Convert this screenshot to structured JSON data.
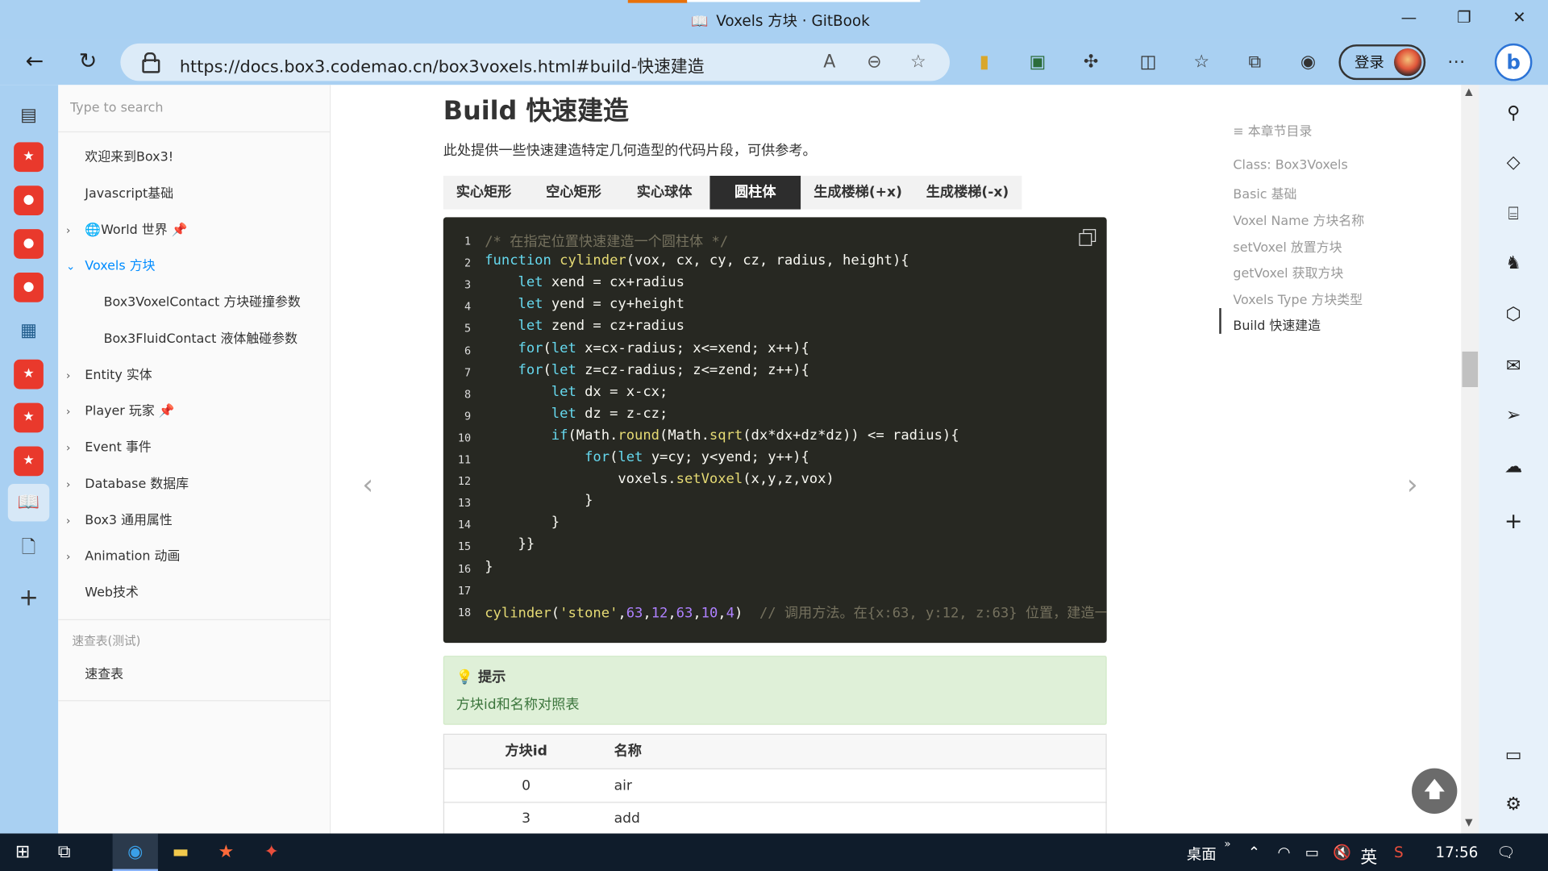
{
  "window": {
    "title": "Voxels 方块 · GitBook",
    "minimize": "—",
    "restore": "❐",
    "close": "✕"
  },
  "browser": {
    "url": "https://docs.box3.codemao.cn/box3voxels.html#build-快速建造",
    "login_label": "登录",
    "bing": "b"
  },
  "sidebar": {
    "search_placeholder": "Type to search",
    "items": [
      {
        "label": "欢迎来到Box3!"
      },
      {
        "label": "Javascript基础"
      },
      {
        "label": "🌐World 世界 📌"
      },
      {
        "label": "Voxels 方块"
      },
      {
        "label": "Box3VoxelContact 方块碰撞参数"
      },
      {
        "label": "Box3FluidContact 液体触碰参数"
      },
      {
        "label": "Entity 实体"
      },
      {
        "label": "Player 玩家 📌"
      },
      {
        "label": "Event 事件"
      },
      {
        "label": "Database 数据库"
      },
      {
        "label": "Box3 通用属性"
      },
      {
        "label": "Animation 动画"
      },
      {
        "label": "Web技术"
      }
    ],
    "section_header": "速查表(测试)",
    "section_item": "速查表"
  },
  "main": {
    "heading": "Build 快速建造",
    "intro": "此处提供一些快速建造特定几何造型的代码片段，可供参考。",
    "tabs": [
      "实心矩形",
      "空心矩形",
      "实心球体",
      "圆柱体",
      "生成楼梯(+x)",
      "生成楼梯(-x)"
    ],
    "selected_tab": "圆柱体",
    "hint_title": "提示",
    "hint_body": "方块id和名称对照表",
    "table": {
      "headers": [
        "方块id",
        "名称"
      ],
      "rows": [
        [
          "0",
          "air"
        ],
        [
          "3",
          "add"
        ]
      ]
    }
  },
  "code": {
    "lines": [
      "/* 在指定位置快速建造一个圆柱体 */",
      "function cylinder(vox, cx, cy, cz, radius, height){",
      "    let xend = cx+radius",
      "    let yend = cy+height",
      "    let zend = cz+radius",
      "    for(let x=cx-radius; x<=xend; x++){",
      "    for(let z=cz-radius; z<=zend; z++){",
      "        let dx = x-cx;",
      "        let dz = z-cz;",
      "        if(Math.round(Math.sqrt(dx*dx+dz*dz)) <= radius){",
      "            for(let y=cy; y<yend; y++){",
      "                voxels.setVoxel(x,y,z,vox)",
      "            }",
      "        }",
      "    }}",
      "}",
      "",
      "cylinder('stone',63,12,63,10,4)  // 调用方法。在{x:63, y:12, z:63} 位置，建造一"
    ]
  },
  "toc": {
    "header": "本章节目录",
    "items": [
      "Class: Box3Voxels",
      "Basic 基础",
      "Voxel Name 方块名称",
      "setVoxel 放置方块",
      "getVoxel 获取方块",
      "Voxels Type 方块类型",
      "Build 快速建造"
    ],
    "active": "Build 快速建造"
  },
  "taskbar": {
    "desktop": "桌面",
    "ime": "英",
    "time": "17:56"
  },
  "colors": {
    "accent": "#008cff",
    "code_bg": "#272822",
    "hint_bg": "#dff0d8",
    "chrome": "#a9d0f2"
  }
}
